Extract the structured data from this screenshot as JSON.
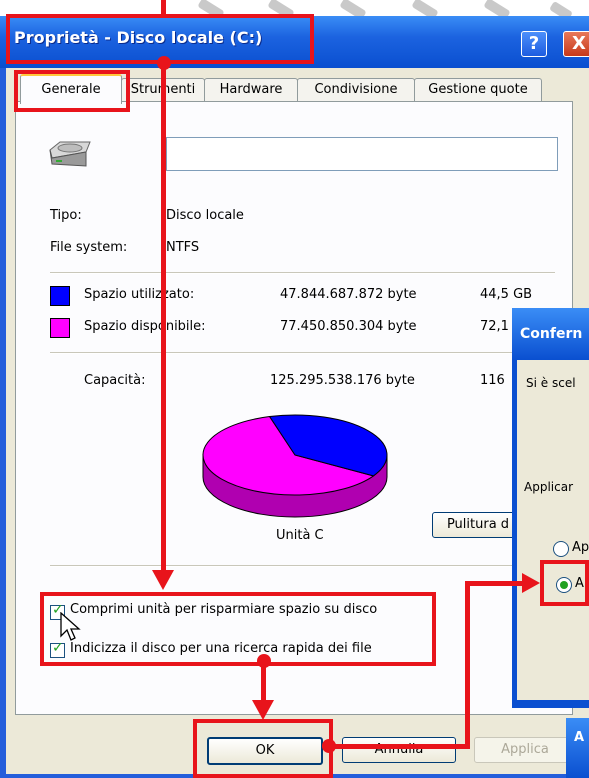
{
  "window": {
    "title": "Proprietà - Disco locale (C:)",
    "help_glyph": "?",
    "close_glyph": "X"
  },
  "tabs": [
    "Generale",
    "Strumenti",
    "Hardware",
    "Condivisione",
    "Gestione quote"
  ],
  "general": {
    "drive_name_value": "",
    "type_label": "Tipo:",
    "type_value": "Disco locale",
    "fs_label": "File system:",
    "fs_value": "NTFS",
    "used_label": "Spazio utilizzato:",
    "used_bytes": "47.844.687.872 byte",
    "used_gb": "44,5 GB",
    "free_label": "Spazio disponibile:",
    "free_bytes": "77.450.850.304 byte",
    "free_gb": "72,1",
    "capacity_label": "Capacità:",
    "capacity_bytes": "125.295.538.176 byte",
    "capacity_gb": "116",
    "drive_caption": "Unità C",
    "cleanup_button": "Pulitura d",
    "compress_label": "Comprimi unità per risparmiare spazio su disco",
    "index_label": "Indicizza il disco per una ricerca rapida dei file",
    "used_fraction": 0.382,
    "colors": {
      "used": "#0000ff",
      "free": "#ff00ff"
    }
  },
  "buttons": {
    "ok": "OK",
    "cancel": "Annulla",
    "apply": "Applica"
  },
  "dialog": {
    "title": "Confern",
    "line1": "Si è scel",
    "line2": "Applicar",
    "option1": "Ap",
    "option2": "Ap",
    "corner_title": "A"
  }
}
